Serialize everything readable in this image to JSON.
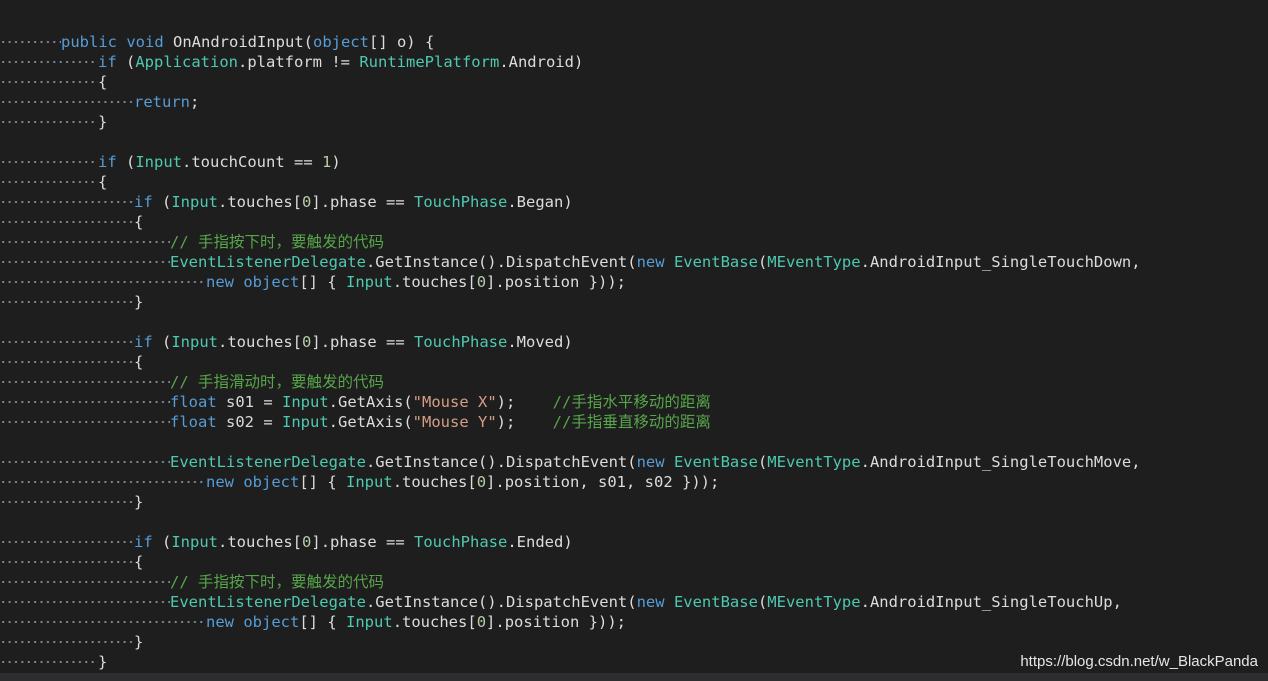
{
  "watermark": "https://blog.csdn.net/w_BlackPanda",
  "colors": {
    "background": "#1e1e1e",
    "keyword": "#569cd6",
    "type": "#4ec9b0",
    "enum_member": "#b8d7a3",
    "string": "#d69d85",
    "number": "#b5cea8",
    "comment": "#57a64a",
    "plain": "#dcdcdc"
  },
  "code_lines": [
    {
      "indent": 2,
      "tokens": [
        [
          "kw",
          "public"
        ],
        [
          "plain",
          " "
        ],
        [
          "kw",
          "void"
        ],
        [
          "plain",
          " OnAndroidInput("
        ],
        [
          "kw",
          "object"
        ],
        [
          "plain",
          "[] o) {"
        ]
      ]
    },
    {
      "indent": 3,
      "tokens": [
        [
          "kw",
          "if"
        ],
        [
          "plain",
          " ("
        ],
        [
          "type",
          "Application"
        ],
        [
          "plain",
          ".platform != "
        ],
        [
          "type",
          "RuntimePlatform"
        ],
        [
          "plain",
          ".Android)"
        ]
      ]
    },
    {
      "indent": 3,
      "tokens": [
        [
          "plain",
          "{"
        ]
      ]
    },
    {
      "indent": 4,
      "tokens": [
        [
          "kw",
          "return"
        ],
        [
          "plain",
          ";"
        ]
      ]
    },
    {
      "indent": 3,
      "tokens": [
        [
          "plain",
          "}"
        ]
      ]
    },
    {
      "indent": 0,
      "tokens": []
    },
    {
      "indent": 3,
      "tokens": [
        [
          "kw",
          "if"
        ],
        [
          "plain",
          " ("
        ],
        [
          "type",
          "Input"
        ],
        [
          "plain",
          ".touchCount == "
        ],
        [
          "num",
          "1"
        ],
        [
          "plain",
          ")"
        ]
      ]
    },
    {
      "indent": 3,
      "tokens": [
        [
          "plain",
          "{"
        ]
      ]
    },
    {
      "indent": 4,
      "tokens": [
        [
          "kw",
          "if"
        ],
        [
          "plain",
          " ("
        ],
        [
          "type",
          "Input"
        ],
        [
          "plain",
          ".touches["
        ],
        [
          "num",
          "0"
        ],
        [
          "plain",
          "].phase == "
        ],
        [
          "type",
          "TouchPhase"
        ],
        [
          "plain",
          ".Began)"
        ]
      ]
    },
    {
      "indent": 4,
      "tokens": [
        [
          "plain",
          "{"
        ]
      ]
    },
    {
      "indent": 5,
      "tokens": [
        [
          "cmt",
          "// 手指按下时，要触发的代码"
        ]
      ]
    },
    {
      "indent": 5,
      "tokens": [
        [
          "type",
          "EventListenerDelegate"
        ],
        [
          "plain",
          ".GetInstance().DispatchEvent("
        ],
        [
          "kw",
          "new"
        ],
        [
          "plain",
          " "
        ],
        [
          "type",
          "EventBase"
        ],
        [
          "plain",
          "("
        ],
        [
          "type",
          "MEventType"
        ],
        [
          "plain",
          ".AndroidInput_SingleTouchDown,"
        ]
      ]
    },
    {
      "indent": 6,
      "tokens": [
        [
          "kw",
          "new"
        ],
        [
          "plain",
          " "
        ],
        [
          "kw",
          "object"
        ],
        [
          "plain",
          "[] { "
        ],
        [
          "type",
          "Input"
        ],
        [
          "plain",
          ".touches["
        ],
        [
          "num",
          "0"
        ],
        [
          "plain",
          "].position }));"
        ]
      ]
    },
    {
      "indent": 4,
      "tokens": [
        [
          "plain",
          "}"
        ]
      ]
    },
    {
      "indent": 0,
      "tokens": []
    },
    {
      "indent": 4,
      "tokens": [
        [
          "kw",
          "if"
        ],
        [
          "plain",
          " ("
        ],
        [
          "type",
          "Input"
        ],
        [
          "plain",
          ".touches["
        ],
        [
          "num",
          "0"
        ],
        [
          "plain",
          "].phase == "
        ],
        [
          "type",
          "TouchPhase"
        ],
        [
          "plain",
          ".Moved)"
        ]
      ]
    },
    {
      "indent": 4,
      "tokens": [
        [
          "plain",
          "{"
        ]
      ]
    },
    {
      "indent": 5,
      "tokens": [
        [
          "cmt",
          "// 手指滑动时，要触发的代码"
        ]
      ]
    },
    {
      "indent": 5,
      "tokens": [
        [
          "kw",
          "float"
        ],
        [
          "plain",
          " s01 = "
        ],
        [
          "type",
          "Input"
        ],
        [
          "plain",
          ".GetAxis("
        ],
        [
          "str",
          "\"Mouse X\""
        ],
        [
          "plain",
          ");    "
        ],
        [
          "cmt",
          "//手指水平移动的距离"
        ]
      ]
    },
    {
      "indent": 5,
      "tokens": [
        [
          "kw",
          "float"
        ],
        [
          "plain",
          " s02 = "
        ],
        [
          "type",
          "Input"
        ],
        [
          "plain",
          ".GetAxis("
        ],
        [
          "str",
          "\"Mouse Y\""
        ],
        [
          "plain",
          ");    "
        ],
        [
          "cmt",
          "//手指垂直移动的距离"
        ]
      ]
    },
    {
      "indent": 0,
      "tokens": []
    },
    {
      "indent": 5,
      "tokens": [
        [
          "type",
          "EventListenerDelegate"
        ],
        [
          "plain",
          ".GetInstance().DispatchEvent("
        ],
        [
          "kw",
          "new"
        ],
        [
          "plain",
          " "
        ],
        [
          "type",
          "EventBase"
        ],
        [
          "plain",
          "("
        ],
        [
          "type",
          "MEventType"
        ],
        [
          "plain",
          ".AndroidInput_SingleTouchMove,"
        ]
      ]
    },
    {
      "indent": 6,
      "tokens": [
        [
          "kw",
          "new"
        ],
        [
          "plain",
          " "
        ],
        [
          "kw",
          "object"
        ],
        [
          "plain",
          "[] { "
        ],
        [
          "type",
          "Input"
        ],
        [
          "plain",
          ".touches["
        ],
        [
          "num",
          "0"
        ],
        [
          "plain",
          "].position, s01, s02 }));"
        ]
      ]
    },
    {
      "indent": 4,
      "tokens": [
        [
          "plain",
          "}"
        ]
      ]
    },
    {
      "indent": 0,
      "tokens": []
    },
    {
      "indent": 4,
      "tokens": [
        [
          "kw",
          "if"
        ],
        [
          "plain",
          " ("
        ],
        [
          "type",
          "Input"
        ],
        [
          "plain",
          ".touches["
        ],
        [
          "num",
          "0"
        ],
        [
          "plain",
          "].phase == "
        ],
        [
          "type",
          "TouchPhase"
        ],
        [
          "plain",
          ".Ended)"
        ]
      ]
    },
    {
      "indent": 4,
      "tokens": [
        [
          "plain",
          "{"
        ]
      ]
    },
    {
      "indent": 5,
      "tokens": [
        [
          "cmt",
          "// 手指按下时，要触发的代码"
        ]
      ]
    },
    {
      "indent": 5,
      "tokens": [
        [
          "type",
          "EventListenerDelegate"
        ],
        [
          "plain",
          ".GetInstance().DispatchEvent("
        ],
        [
          "kw",
          "new"
        ],
        [
          "plain",
          " "
        ],
        [
          "type",
          "EventBase"
        ],
        [
          "plain",
          "("
        ],
        [
          "type",
          "MEventType"
        ],
        [
          "plain",
          ".AndroidInput_SingleTouchUp,"
        ]
      ]
    },
    {
      "indent": 6,
      "tokens": [
        [
          "kw",
          "new"
        ],
        [
          "plain",
          " "
        ],
        [
          "kw",
          "object"
        ],
        [
          "plain",
          "[] { "
        ],
        [
          "type",
          "Input"
        ],
        [
          "plain",
          ".touches["
        ],
        [
          "num",
          "0"
        ],
        [
          "plain",
          "].position }));"
        ]
      ]
    },
    {
      "indent": 4,
      "tokens": [
        [
          "plain",
          "}"
        ]
      ]
    },
    {
      "indent": 3,
      "tokens": [
        [
          "plain",
          "}"
        ]
      ]
    }
  ]
}
